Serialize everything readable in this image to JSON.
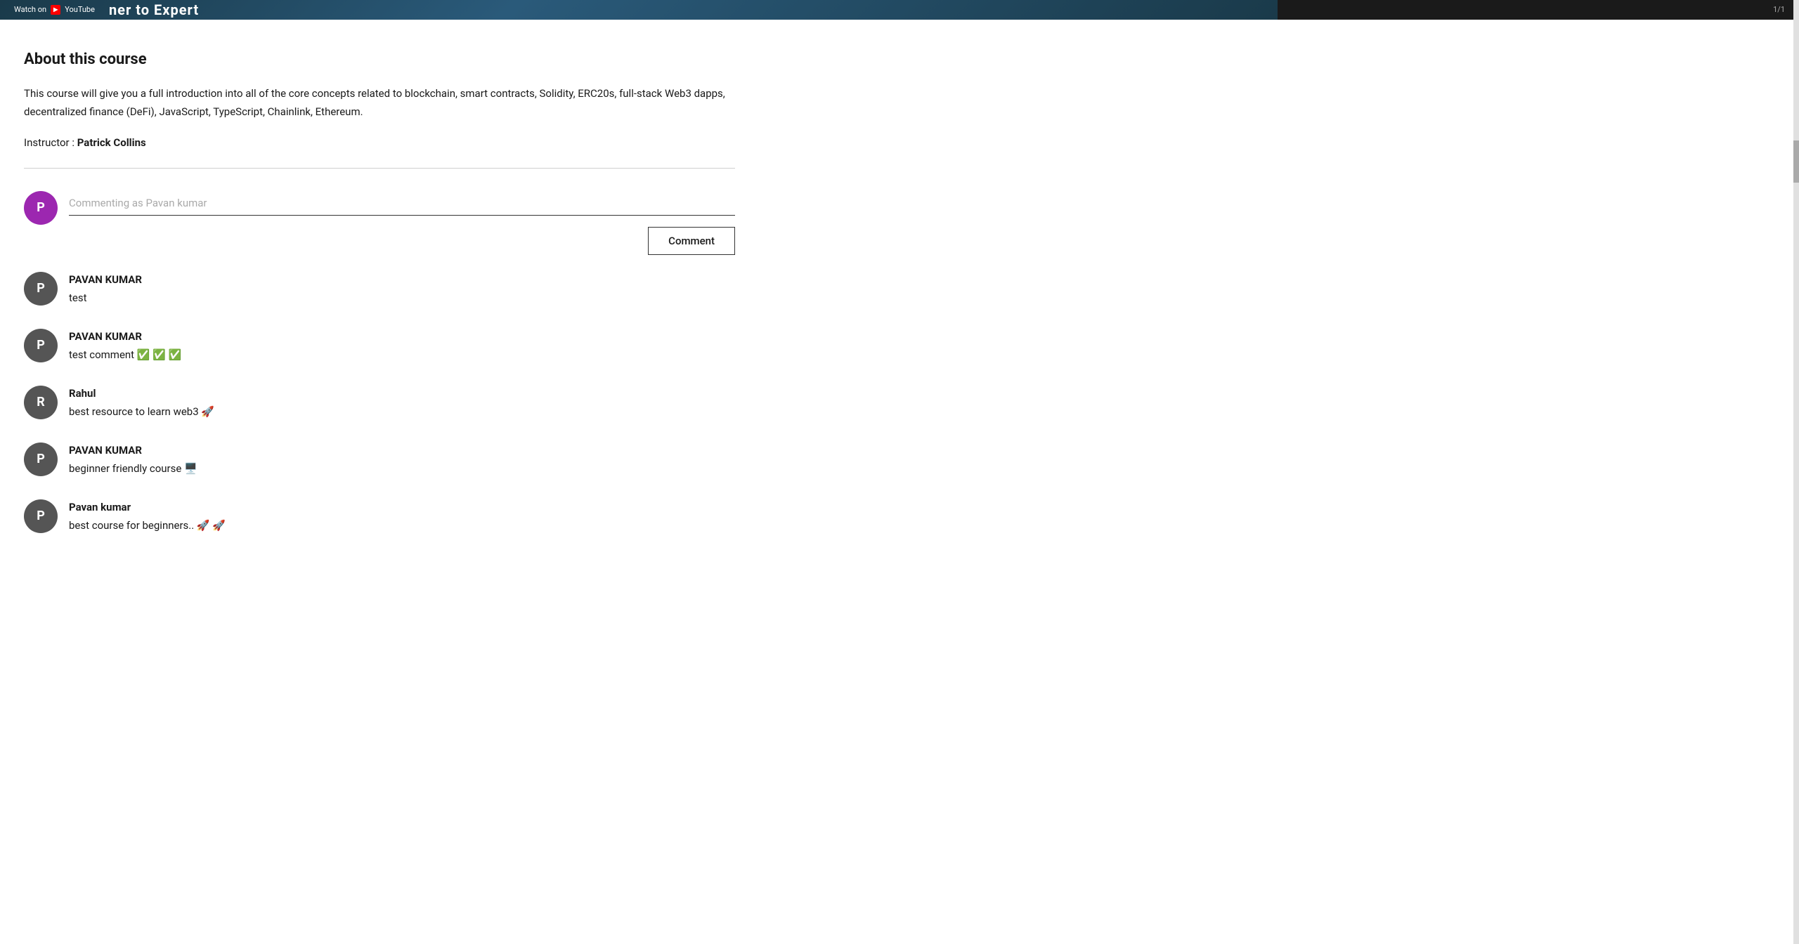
{
  "banner": {
    "watch_on": "Watch on",
    "youtube_label": "YouTube",
    "title": "r to Exper",
    "timer": "1/1"
  },
  "course": {
    "section_title": "About this course",
    "description": "This course will give you a full introduction into all of the core concepts related to blockchain, smart contracts, Solidity, ERC20s, full-stack Web3 dapps, decentralized finance (DeFi), JavaScript, TypeScript, Chainlink, Ethereum.",
    "instructor_label": "Instructor :",
    "instructor_name": "Patrick Collins"
  },
  "comment_input": {
    "placeholder": "Commenting as Pavan kumar",
    "button_label": "Comment",
    "user_initial": "P"
  },
  "comments": [
    {
      "id": 1,
      "author": "PAVAN KUMAR",
      "text": "test",
      "emojis": ""
    },
    {
      "id": 2,
      "author": "PAVAN KUMAR",
      "text": "test comment ✅ ✅ ✅",
      "emojis": ""
    },
    {
      "id": 3,
      "author": "Rahul",
      "text": "best resource to learn web3 🚀",
      "emojis": ""
    },
    {
      "id": 4,
      "author": "PAVAN KUMAR",
      "text": "beginner friendly course 🖥️",
      "emojis": ""
    },
    {
      "id": 5,
      "author": "Pavan kumar",
      "text": "best course for beginners.. 🚀 🚀",
      "emojis": ""
    }
  ]
}
